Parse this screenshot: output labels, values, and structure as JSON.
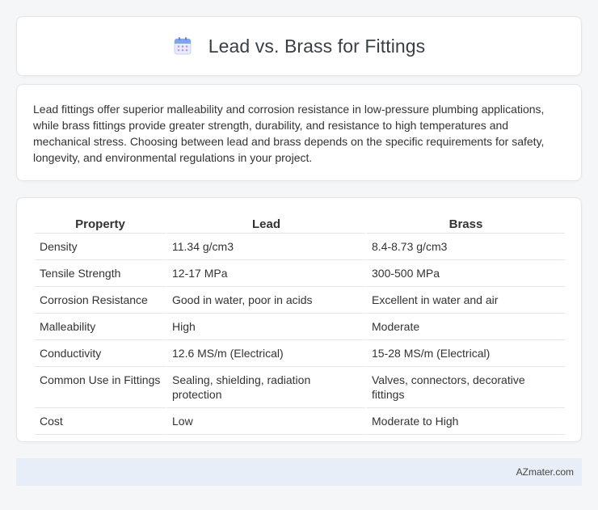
{
  "header": {
    "title": "Lead vs. Brass for Fittings",
    "icon": "calendar-icon"
  },
  "summary": {
    "text": "Lead fittings offer superior malleability and corrosion resistance in low-pressure plumbing applications, while brass fittings provide greater strength, durability, and resistance to high temperatures and mechanical stress. Choosing between lead and brass depends on the specific requirements for safety, longevity, and environmental regulations in your project."
  },
  "table": {
    "headers": [
      "Property",
      "Lead",
      "Brass"
    ],
    "rows": [
      [
        "Density",
        "11.34 g/cm3",
        "8.4-8.73 g/cm3"
      ],
      [
        "Tensile Strength",
        "12-17 MPa",
        "300-500 MPa"
      ],
      [
        "Corrosion Resistance",
        "Good in water, poor in acids",
        "Excellent in water and air"
      ],
      [
        "Malleability",
        "High",
        "Moderate"
      ],
      [
        "Conductivity",
        "12.6 MS/m (Electrical)",
        "15-28 MS/m (Electrical)"
      ],
      [
        "Common Use in Fittings",
        "Sealing, shielding, radiation protection",
        "Valves, connectors, decorative fittings"
      ],
      [
        "Cost",
        "Low",
        "Moderate to High"
      ]
    ]
  },
  "footer": {
    "text": "AZmater.com"
  },
  "colors": {
    "background": "#f5f6f8",
    "card": "#ffffff",
    "footer_bg": "#e8eef7",
    "icon_accent": "#8b7fd6"
  }
}
